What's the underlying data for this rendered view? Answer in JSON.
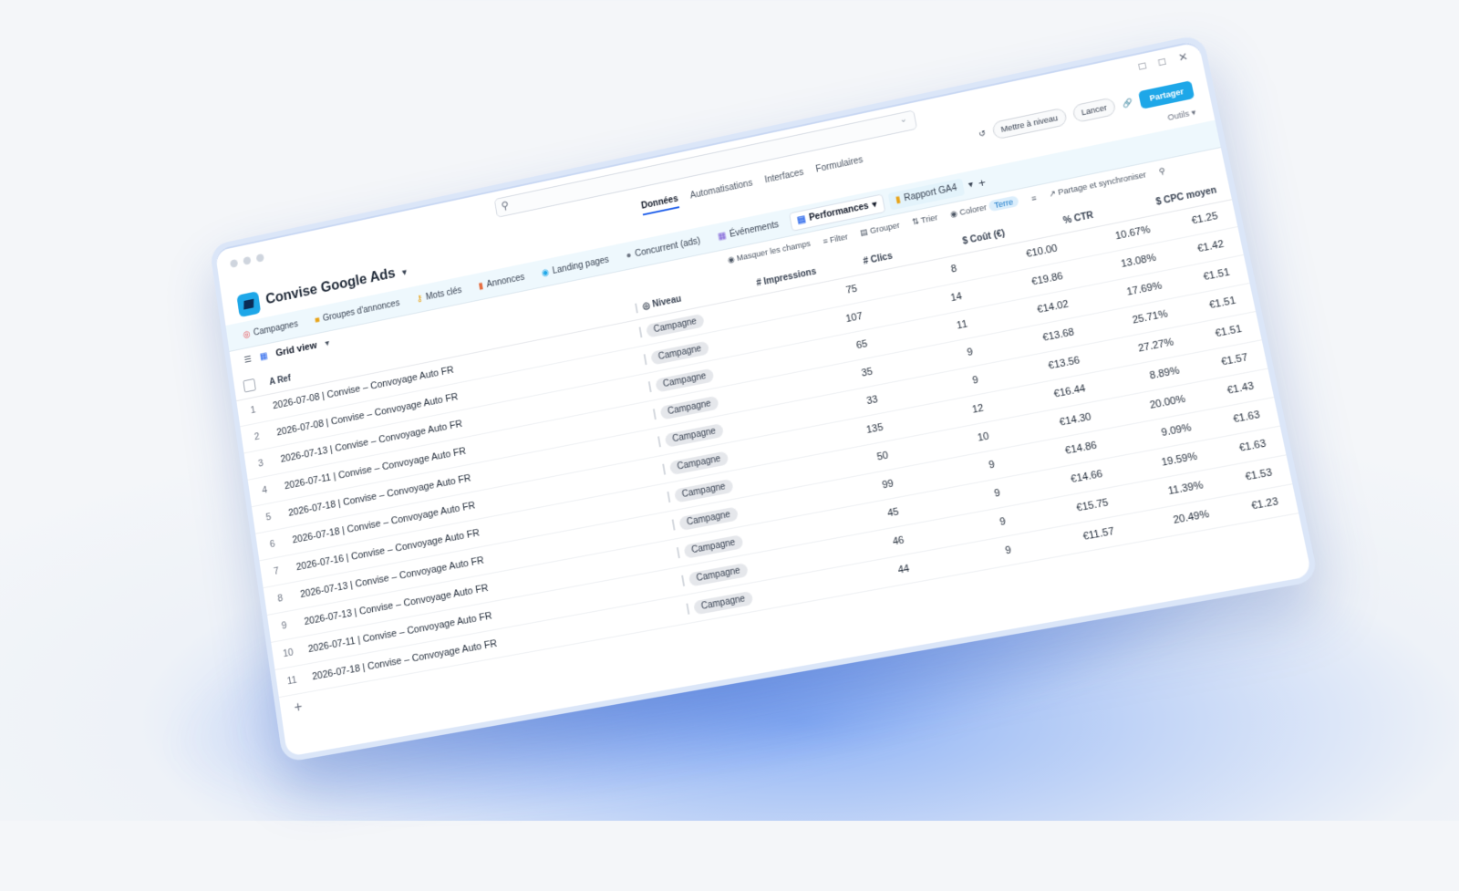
{
  "app": {
    "title": "Convise Google Ads",
    "search_placeholder": ""
  },
  "nav_tabs": [
    "Données",
    "Automatisations",
    "Interfaces",
    "Formulaires"
  ],
  "header_buttons": {
    "upgrade": "Mettre à niveau",
    "launch": "Lancer",
    "share": "Partager",
    "tools": "Outils"
  },
  "tables": [
    {
      "label": "Campagnes",
      "icon": "target-icon"
    },
    {
      "label": "Groupes d'annonces",
      "icon": "folder-icon"
    },
    {
      "label": "Mots clés",
      "icon": "key-icon"
    },
    {
      "label": "Annonces",
      "icon": "ad-icon"
    },
    {
      "label": "Landing pages",
      "icon": "globe-icon"
    },
    {
      "label": "Concurrent (ads)",
      "icon": "dot-icon"
    },
    {
      "label": "Événements",
      "icon": "calendar-icon"
    },
    {
      "label": "Performances",
      "icon": "chart-icon"
    },
    {
      "label": "Rapport GA4",
      "icon": "report-icon"
    }
  ],
  "toolbar": {
    "view_name": "Grid view",
    "hide_fields": "Masquer les champs",
    "filter": "Filter",
    "group": "Grouper",
    "sort": "Trier",
    "color": "Colorer",
    "color_chip": "Terre",
    "share_sync": "Partage et synchroniser"
  },
  "columns": {
    "ref": "Ref",
    "niveau": "Niveau",
    "impressions": "Impressions",
    "clics": "Clics",
    "cout": "Coût (€)",
    "ctr": "CTR",
    "cpc": "CPC moyen (€)"
  },
  "rows": [
    {
      "n": "1",
      "ref": "2026-07-08 | Convise – Convoyage Auto FR",
      "niveau": "Campagne",
      "impressions": "75",
      "clics": "8",
      "cout": "€10.00",
      "ctr": "10.67%",
      "cpc": "€1.25"
    },
    {
      "n": "2",
      "ref": "2026-07-08 | Convise – Convoyage Auto FR",
      "niveau": "Campagne",
      "impressions": "107",
      "clics": "14",
      "cout": "€19.86",
      "ctr": "13.08%",
      "cpc": "€1.42"
    },
    {
      "n": "3",
      "ref": "2026-07-13 | Convise – Convoyage Auto FR",
      "niveau": "Campagne",
      "impressions": "65",
      "clics": "11",
      "cout": "€14.02",
      "ctr": "17.69%",
      "cpc": "€1.51"
    },
    {
      "n": "4",
      "ref": "2026-07-11 | Convise – Convoyage Auto FR",
      "niveau": "Campagne",
      "impressions": "35",
      "clics": "9",
      "cout": "€13.68",
      "ctr": "25.71%",
      "cpc": "€1.51"
    },
    {
      "n": "5",
      "ref": "2026-07-18 | Convise – Convoyage Auto FR",
      "niveau": "Campagne",
      "impressions": "33",
      "clics": "9",
      "cout": "€13.56",
      "ctr": "27.27%",
      "cpc": "€1.51"
    },
    {
      "n": "6",
      "ref": "2026-07-18 | Convise – Convoyage Auto FR",
      "niveau": "Campagne",
      "impressions": "135",
      "clics": "12",
      "cout": "€16.44",
      "ctr": "8.89%",
      "cpc": "€1.57"
    },
    {
      "n": "7",
      "ref": "2026-07-16 | Convise – Convoyage Auto FR",
      "niveau": "Campagne",
      "impressions": "50",
      "clics": "10",
      "cout": "€14.30",
      "ctr": "20.00%",
      "cpc": "€1.43"
    },
    {
      "n": "8",
      "ref": "2026-07-13 | Convise – Convoyage Auto FR",
      "niveau": "Campagne",
      "impressions": "99",
      "clics": "9",
      "cout": "€14.86",
      "ctr": "9.09%",
      "cpc": "€1.63"
    },
    {
      "n": "9",
      "ref": "2026-07-13 | Convise – Convoyage Auto FR",
      "niveau": "Campagne",
      "impressions": "45",
      "clics": "9",
      "cout": "€14.66",
      "ctr": "19.59%",
      "cpc": "€1.63"
    },
    {
      "n": "10",
      "ref": "2026-07-11 | Convise – Convoyage Auto FR",
      "niveau": "Campagne",
      "impressions": "46",
      "clics": "9",
      "cout": "€15.75",
      "ctr": "11.39%",
      "cpc": "€1.53"
    },
    {
      "n": "11",
      "ref": "2026-07-18 | Convise – Convoyage Auto FR",
      "niveau": "Campagne",
      "impressions": "44",
      "clics": "9",
      "cout": "€11.57",
      "ctr": "20.49%",
      "cpc": "€1.23"
    }
  ],
  "colors": {
    "accent": "#1ea7e8",
    "tablebar_bg": "#eef8fd"
  }
}
